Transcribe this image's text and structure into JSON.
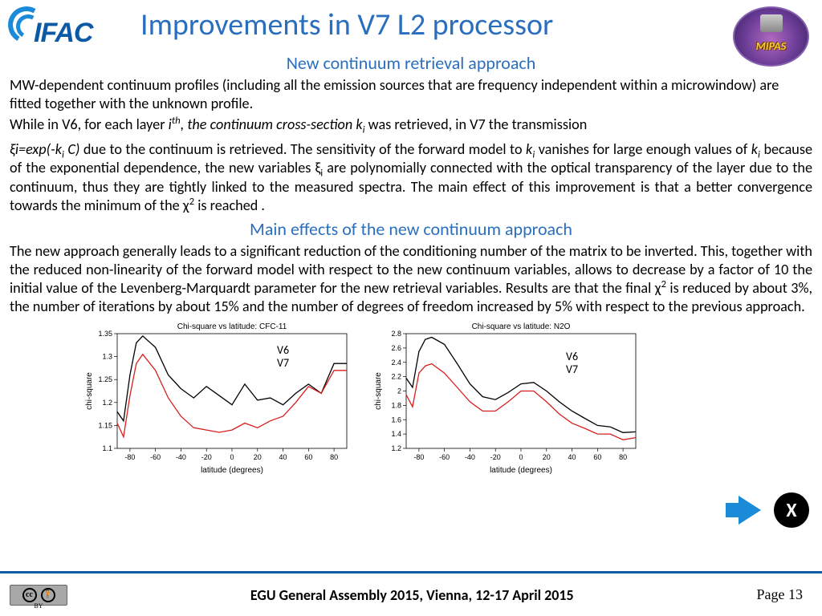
{
  "header": {
    "logo_left_text": "IFAC",
    "title": "Improvements in V7 L2 processor",
    "logo_right_text": "MIPAS",
    "subtitle": "New continuum retrieval approach"
  },
  "body": {
    "para1_a": "MW-dependent continuum profiles (including all the emission sources that are frequency independent within a microwindow) are fitted together  with the unknown profile.",
    "para1_b_pre": "While in V6, for each layer ",
    "para1_b_ith": "i",
    "para1_b_th": "th",
    "para1_b_mid": ", the continuum cross-section ",
    "para1_b_k": "k",
    "para1_b_i": "i",
    "para1_b_post": " was retrieved, in V7 the transmission",
    "para2_pre": "ξi=exp(-k",
    "para2_i": "i",
    "para2_a": " C)",
    "para2_mid": " due to the continuum is retrieved. The sensitivity of the forward model to ",
    "para2_k2": "k",
    "para2_i2": "i",
    "para2_b": " vanishes for large enough values of ",
    "para2_k3": "k",
    "para2_i3": "i",
    "para2_c": " because of the exponential dependence, the new variables ξ",
    "para2_i4": "i",
    "para2_d": " are polynomially connected with the optical transparency of the layer due to the continuum, thus they are tightly linked to the measured spectra. The main effect of this improvement is that a better convergence towards the minimum of the χ",
    "para2_sup2": "2",
    "para2_e": " is reached .",
    "section2": "Main effects of the new continuum approach",
    "para3_a": "The new approach generally leads to a significant reduction of the conditioning number of the matrix to be inverted. This, together with the reduced non-linearity of the forward model with respect to the new continuum variables, allows to decrease by a factor of 10 the initial value of the Levenberg-Marquardt parameter for the new retrieval variables. Results are that the final  χ",
    "para3_sup2": "2",
    "para3_b": " is reduced by about 3%, the number of iterations by about 15% and the number of degrees of freedom increased by 5% with respect to the previous approach."
  },
  "legends": {
    "v6": "V6",
    "v7": "V7"
  },
  "nav": {
    "close_label": "X"
  },
  "footer": {
    "cc_by": "BY",
    "center": "EGU General Assembly 2015, Vienna, 12-17 April 2015",
    "right": "Page 13"
  },
  "chart_data": [
    {
      "type": "line",
      "title": "Chi-square vs latitude: CFC-11",
      "xlabel": "latitude (degrees)",
      "ylabel": "chi-square",
      "xlim": [
        -90,
        90
      ],
      "ylim": [
        1.1,
        1.35
      ],
      "xticks": [
        -80,
        -60,
        -40,
        -20,
        0,
        20,
        40,
        60,
        80
      ],
      "yticks": [
        1.1,
        1.15,
        1.2,
        1.25,
        1.3,
        1.35
      ],
      "series": [
        {
          "name": "V6",
          "color": "#000000",
          "x": [
            -90,
            -85,
            -80,
            -75,
            -70,
            -60,
            -50,
            -40,
            -30,
            -20,
            -10,
            0,
            10,
            20,
            30,
            40,
            50,
            60,
            70,
            80,
            90
          ],
          "y": [
            1.18,
            1.16,
            1.26,
            1.33,
            1.345,
            1.32,
            1.26,
            1.23,
            1.21,
            1.235,
            1.215,
            1.195,
            1.24,
            1.205,
            1.21,
            1.195,
            1.22,
            1.24,
            1.22,
            1.285,
            1.285
          ]
        },
        {
          "name": "V7",
          "color": "#d81e1e",
          "x": [
            -90,
            -85,
            -80,
            -75,
            -70,
            -60,
            -50,
            -40,
            -30,
            -20,
            -10,
            0,
            10,
            20,
            30,
            40,
            50,
            60,
            70,
            80,
            90
          ],
          "y": [
            1.155,
            1.125,
            1.215,
            1.285,
            1.305,
            1.27,
            1.21,
            1.17,
            1.145,
            1.14,
            1.135,
            1.14,
            1.155,
            1.145,
            1.16,
            1.17,
            1.2,
            1.235,
            1.22,
            1.27,
            1.27
          ]
        }
      ]
    },
    {
      "type": "line",
      "title": "Chi-square vs latitude: N2O",
      "xlabel": "latitude (degrees)",
      "ylabel": "chi-square",
      "xlim": [
        -90,
        90
      ],
      "ylim": [
        1.2,
        2.8
      ],
      "xticks": [
        -80,
        -60,
        -40,
        -20,
        0,
        20,
        40,
        60,
        80
      ],
      "yticks": [
        1.2,
        1.4,
        1.6,
        1.8,
        2.0,
        2.2,
        2.4,
        2.6,
        2.8
      ],
      "series": [
        {
          "name": "V6",
          "color": "#000000",
          "x": [
            -90,
            -85,
            -80,
            -75,
            -70,
            -60,
            -50,
            -40,
            -30,
            -20,
            -10,
            0,
            10,
            20,
            30,
            40,
            50,
            60,
            70,
            80,
            90
          ],
          "y": [
            2.18,
            2.05,
            2.55,
            2.72,
            2.75,
            2.65,
            2.38,
            2.1,
            1.92,
            1.88,
            1.98,
            2.1,
            2.12,
            2.0,
            1.85,
            1.72,
            1.62,
            1.52,
            1.5,
            1.42,
            1.43
          ]
        },
        {
          "name": "V7",
          "color": "#d81e1e",
          "x": [
            -90,
            -85,
            -80,
            -75,
            -70,
            -60,
            -50,
            -40,
            -30,
            -20,
            -10,
            0,
            10,
            20,
            30,
            40,
            50,
            60,
            70,
            80,
            90
          ],
          "y": [
            1.95,
            1.78,
            2.25,
            2.35,
            2.38,
            2.25,
            2.05,
            1.85,
            1.72,
            1.72,
            1.85,
            2.0,
            2.0,
            1.85,
            1.68,
            1.55,
            1.48,
            1.4,
            1.4,
            1.32,
            1.35
          ]
        }
      ]
    }
  ]
}
